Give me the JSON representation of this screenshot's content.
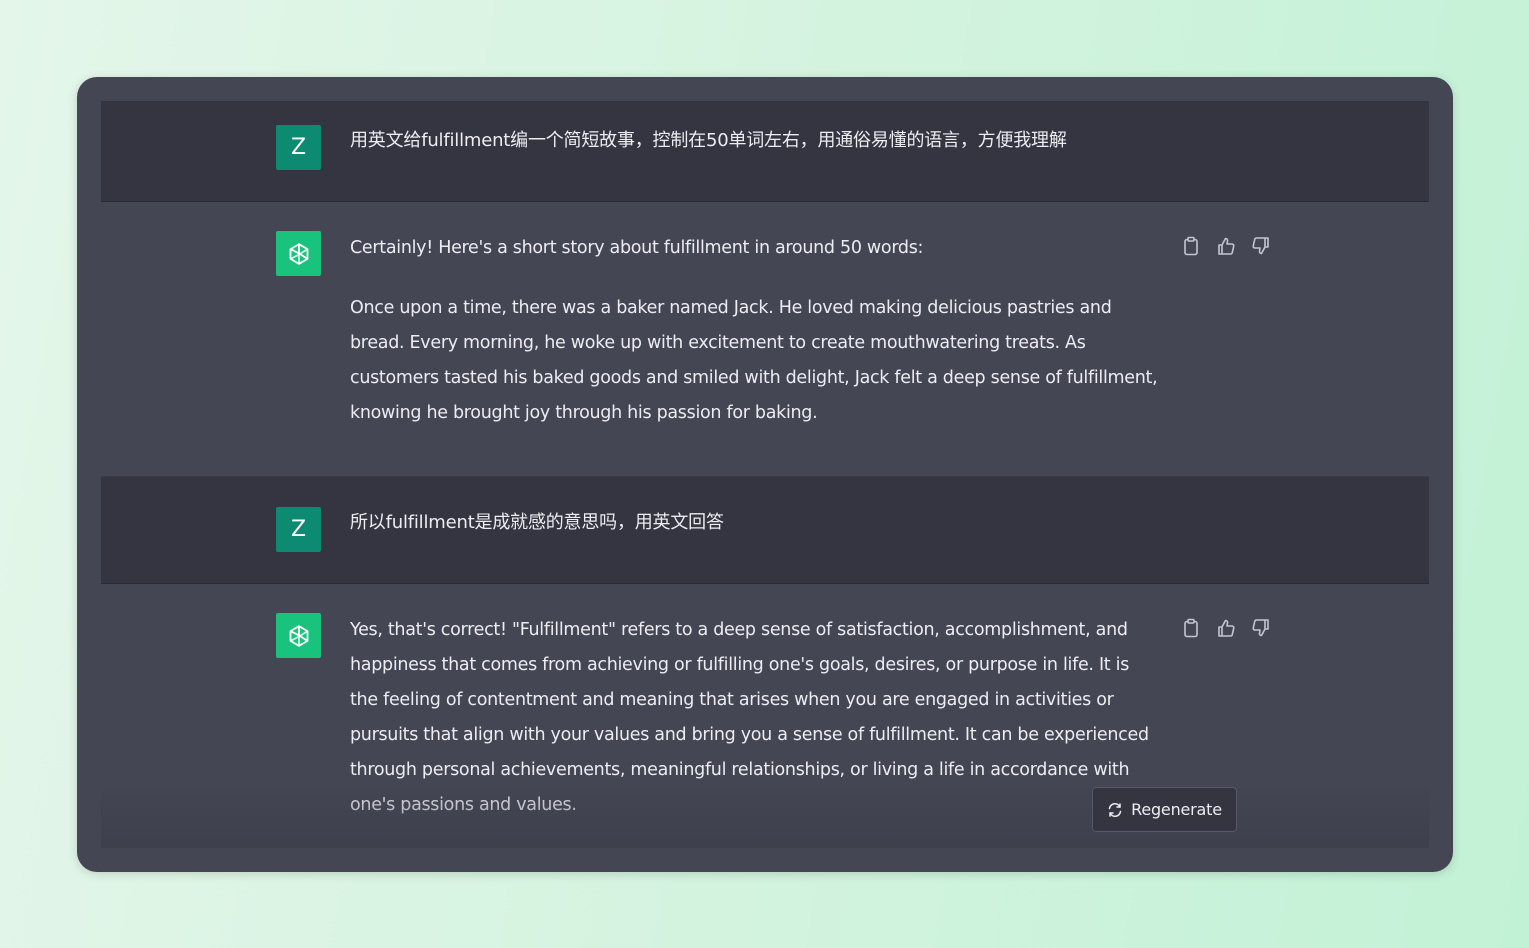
{
  "messages": [
    {
      "role": "user",
      "avatar_letter": "Z",
      "paragraphs": [
        "用英文给fulfillment编一个简短故事，控制在50单词左右，用通俗易懂的语言，方便我理解"
      ]
    },
    {
      "role": "assistant",
      "avatar_icon": "openai-logo-icon",
      "paragraphs": [
        "Certainly! Here's a short story about fulfillment in around 50 words:",
        "Once upon a time, there was a baker named Jack. He loved making delicious pastries and bread. Every morning, he woke up with excitement to create mouthwatering treats. As customers tasted his baked goods and smiled with delight, Jack felt a deep sense of fulfillment, knowing he brought joy through his passion for baking."
      ]
    },
    {
      "role": "user",
      "avatar_letter": "Z",
      "paragraphs": [
        "所以fulfillment是成就感的意思吗，用英文回答"
      ]
    },
    {
      "role": "assistant",
      "avatar_icon": "openai-logo-icon",
      "paragraphs": [
        "Yes, that's correct! \"Fulfillment\" refers to a deep sense of satisfaction, accomplishment, and happiness that comes from achieving or fulfilling one's goals, desires, or purpose in life. It is the feeling of contentment and meaning that arises when you are engaged in activities or pursuits that align with your values and bring you a sense of fulfillment. It can be experienced through personal achievements, meaningful relationships, or living a life in accordance with one's passions and values."
      ]
    }
  ],
  "message_actions": [
    "clipboard-icon",
    "thumbs-up-icon",
    "thumbs-down-icon"
  ],
  "regenerate": {
    "label": "Regenerate",
    "icon": "refresh-icon"
  },
  "colors": {
    "user_bg": "#343541",
    "assistant_bg": "#444654",
    "user_avatar": "#0d8a72",
    "assistant_avatar": "#19c37d",
    "text": "#ececf1"
  }
}
